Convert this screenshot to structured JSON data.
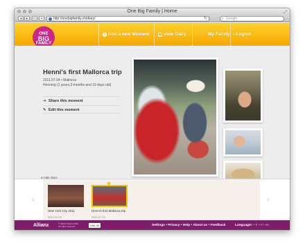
{
  "window": {
    "title": "One Big Family | Home"
  },
  "toolbar": {
    "url": "http://onebigfamily.ch/diary/",
    "search_placeholder": "Google"
  },
  "logo": {
    "line1": "ONE",
    "line2": "BIG",
    "line3": "FAMILY"
  },
  "nav": {
    "add_moment": "Add a new Moment",
    "view_diary": "View Diary",
    "my_family": "My Family",
    "logout": "Logout"
  },
  "moment": {
    "title": "Henni's first Mallorca trip",
    "date_place": "2011.07.04 • Mallorca",
    "age": "Henning (1 years,3 months and 19 days old)",
    "share_label": "Share this moment",
    "edit_label": "Edit this moment"
  },
  "diary": {
    "hide_label": "Hide diary",
    "entries": [
      {
        "title": "New York City 2011",
        "date": "2012.03.09"
      },
      {
        "title": "Henni's first Mallorca trip",
        "date": "2011.07.04"
      }
    ]
  },
  "footer": {
    "brand": "Allianz",
    "copyright_line1": "© Allianz Suisse 2012",
    "copyright_line2": "All rights reserved",
    "social_like": "Like",
    "social_count": "2k",
    "links": [
      "Settings",
      "Privacy",
      "Help",
      "About us",
      "Feedback"
    ],
    "language_label": "Language",
    "language_options": "de • fr • it • en"
  },
  "colors": {
    "accent_yellow": "#f6b400",
    "brand_magenta": "#c8288a",
    "footer_purple": "#7e1e6a"
  }
}
